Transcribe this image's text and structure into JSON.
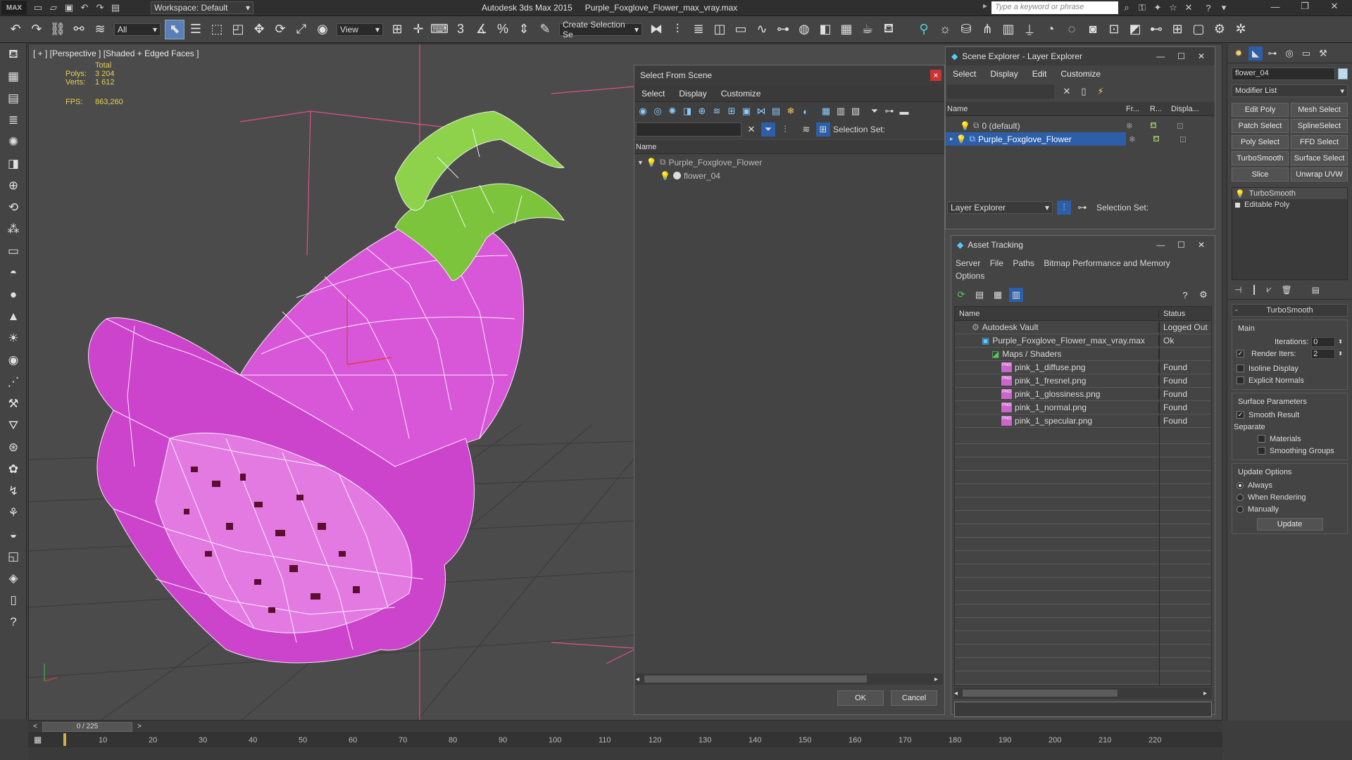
{
  "title_bar": {
    "app_title": "Autodesk 3ds Max  2015",
    "file_name": "Purple_Foxglove_Flower_max_vray.max",
    "workspace": "Workspace: Default",
    "search_placeholder": "Type a keyword or phrase",
    "logo": "MAX"
  },
  "main_toolbar": {
    "filter_value": "All",
    "ref_coord_value": "View",
    "named_selection_placeholder": "Create Selection Se"
  },
  "viewport": {
    "label": "[ + ] [Perspective ] [Shaded + Edged Faces ]",
    "stats": {
      "total_label": "Total",
      "polys_label": "Polys:",
      "polys_value": "3 204",
      "verts_label": "Verts:",
      "verts_value": "1 612",
      "fps_label": "FPS:",
      "fps_value": "863,260"
    }
  },
  "select_from_scene": {
    "title": "Select From Scene",
    "close": "×",
    "menu": [
      "Select",
      "Display",
      "Customize"
    ],
    "selection_set_label": "Selection Set:",
    "column_name": "Name",
    "items": [
      {
        "label": "Purple_Foxglove_Flower"
      },
      {
        "label": "flower_04"
      }
    ],
    "ok_label": "OK",
    "cancel_label": "Cancel"
  },
  "scene_explorer": {
    "title": "Scene Explorer - Layer Explorer",
    "menu": [
      "Select",
      "Display",
      "Edit",
      "Customize"
    ],
    "columns": [
      "Name",
      "Fr...",
      "R...",
      "Displa..."
    ],
    "rows": [
      {
        "label": "0 (default)",
        "selected": false
      },
      {
        "label": "Purple_Foxglove_Flower",
        "selected": true
      }
    ],
    "footer_dropdown": "Layer Explorer",
    "selection_set_label": "Selection Set:"
  },
  "asset_tracking": {
    "title": "Asset Tracking",
    "menu": [
      "Server",
      "File",
      "Paths",
      "Bitmap Performance and Memory",
      "Options"
    ],
    "columns": [
      "Name",
      "Status"
    ],
    "rows": [
      {
        "name": "Autodesk Vault",
        "status": "Logged Out"
      },
      {
        "name": "Purple_Foxglove_Flower_max_vray.max",
        "status": "Ok"
      },
      {
        "name": "Maps / Shaders",
        "status": ""
      },
      {
        "name": "pink_1_diffuse.png",
        "status": "Found"
      },
      {
        "name": "pink_1_fresnel.png",
        "status": "Found"
      },
      {
        "name": "pink_1_glossiness.png",
        "status": "Found"
      },
      {
        "name": "pink_1_normal.png",
        "status": "Found"
      },
      {
        "name": "pink_1_specular.png",
        "status": "Found"
      }
    ],
    "png_badge": "PNG"
  },
  "command_panel": {
    "object_name": "flower_04",
    "modifier_list": "Modifier List",
    "modifier_buttons": [
      "Edit Poly",
      "Mesh Select",
      "Patch Select",
      "SplineSelect",
      "Poly Select",
      "FFD Select",
      "TurboSmooth",
      "Surface Select",
      "Slice",
      "Unwrap UVW"
    ],
    "stack": [
      "TurboSmooth",
      "Editable Poly"
    ],
    "rollout_title": "TurboSmooth",
    "main_label": "Main",
    "iterations_label": "Iterations:",
    "iterations_value": "0",
    "render_iters_label": "Render Iters:",
    "render_iters_value": "2",
    "isoline_label": "Isoline Display",
    "explicit_normals_label": "Explicit Normals",
    "surface_params_label": "Surface Parameters",
    "smooth_result_label": "Smooth Result",
    "separate_label": "Separate",
    "materials_label": "Materials",
    "smoothing_groups_label": "Smoothing Groups",
    "update_options_label": "Update Options",
    "always_label": "Always",
    "when_rendering_label": "When Rendering",
    "manually_label": "Manually",
    "update_button": "Update"
  },
  "timeline": {
    "frame_counter": "0 / 225",
    "ticks": [
      "10",
      "20",
      "30",
      "40",
      "50",
      "60",
      "70",
      "80",
      "90",
      "100",
      "110",
      "120",
      "130",
      "140",
      "150",
      "160",
      "170",
      "180",
      "190",
      "200",
      "210",
      "220"
    ]
  },
  "colors": {
    "selection_blue": "#2d5ea8",
    "stat_yellow": "#e8d050",
    "flower_pink": "#d648d6",
    "leaf_green": "#7cc43c"
  }
}
